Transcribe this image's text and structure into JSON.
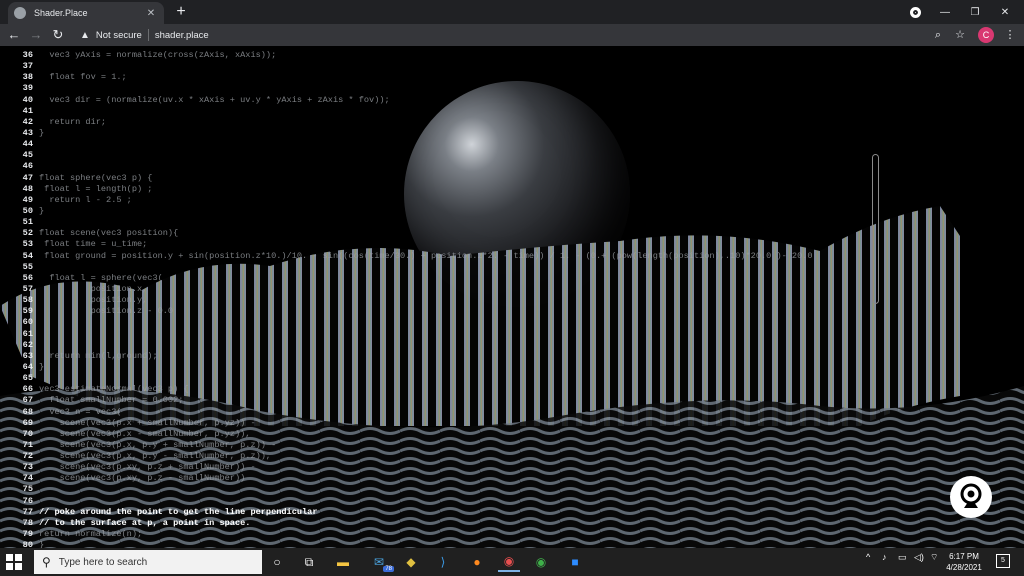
{
  "browser": {
    "tab_title": "Shader.Place",
    "tab_close": "✕",
    "new_tab": "+",
    "window_controls": {
      "minimize": "—",
      "restore": "❐",
      "close": "✕"
    },
    "security_label": "Not secure",
    "url": "shader.place",
    "profile_initial": "C"
  },
  "editor": {
    "lines": [
      {
        "n": "36",
        "code": "  vec3 yAxis = normalize(cross(zAxis, xAxis));"
      },
      {
        "n": "37",
        "code": ""
      },
      {
        "n": "38",
        "code": "  float fov = 1.;"
      },
      {
        "n": "39",
        "code": ""
      },
      {
        "n": "40",
        "code": "  vec3 dir = (normalize(uv.x * xAxis + uv.y * yAxis + zAxis * fov));"
      },
      {
        "n": "41",
        "code": ""
      },
      {
        "n": "42",
        "code": "  return dir;"
      },
      {
        "n": "43",
        "code": "}"
      },
      {
        "n": "44",
        "code": ""
      },
      {
        "n": "45",
        "code": ""
      },
      {
        "n": "46",
        "code": ""
      },
      {
        "n": "47",
        "code": "float sphere(vec3 p) {"
      },
      {
        "n": "48",
        "code": " float l = length(p) ;"
      },
      {
        "n": "49",
        "code": "  return l - 2.5 ;"
      },
      {
        "n": "50",
        "code": "}"
      },
      {
        "n": "51",
        "code": ""
      },
      {
        "n": "52",
        "code": "float scene(vec3 position){"
      },
      {
        "n": "53",
        "code": " float time = u_time;"
      },
      {
        "n": "54",
        "code": " float ground = position.y + sin(position.z*10.)/10. - sin((cos(time/30.) + position.z*2. - time)) / 1. - (0.+ (pow(length(position),.10)*20.0 )- 20.0"
      },
      {
        "n": "55",
        "code": ""
      },
      {
        "n": "56",
        "code": "  float l = sphere(vec3("
      },
      {
        "n": "57",
        "code": "          position.x,"
      },
      {
        "n": "58",
        "code": "          position.y,"
      },
      {
        "n": "59",
        "code": "          position.z - 0.0"
      },
      {
        "n": "60",
        "code": ""
      },
      {
        "n": "61",
        "code": ""
      },
      {
        "n": "62",
        "code": ""
      },
      {
        "n": "63",
        "code": "  return min(l,ground);"
      },
      {
        "n": "64",
        "code": "}"
      },
      {
        "n": "65",
        "code": ""
      },
      {
        "n": "66",
        "code": "vec3 estimateNormal(vec3 p) {"
      },
      {
        "n": "67",
        "code": "  float smallNumber = 0.002;"
      },
      {
        "n": "68",
        "code": "  vec3 n = vec3("
      },
      {
        "n": "69",
        "code": "    scene(vec3(p.x + smallNumber, p.yz)) -"
      },
      {
        "n": "70",
        "code": "    scene(vec3(p.x - smallNumber, p.yz)),"
      },
      {
        "n": "71",
        "code": "    scene(vec3(p.x, p.y + smallNumber, p.z)) -"
      },
      {
        "n": "72",
        "code": "    scene(vec3(p.x, p.y - smallNumber, p.z)),"
      },
      {
        "n": "73",
        "code": "    scene(vec3(p.xy, p.z + smallNumber)) -"
      },
      {
        "n": "74",
        "code": "    scene(vec3(p.xy, p.z - smallNumber))"
      },
      {
        "n": "75",
        "code": ""
      },
      {
        "n": "76",
        "code": ""
      },
      {
        "n": "77",
        "code": "// poke around the point to get the line perpendicular",
        "highlight": true
      },
      {
        "n": "78",
        "code": "// to the surface at p, a point in space.",
        "highlight": true
      },
      {
        "n": "79",
        "code": "return normalize(n);"
      },
      {
        "n": "80",
        "code": "}"
      }
    ]
  },
  "taskbar": {
    "search_placeholder": "Type here to search",
    "mail_badge": "78",
    "time": "6:17 PM",
    "date": "4/28/2021",
    "notification_count": "5"
  }
}
